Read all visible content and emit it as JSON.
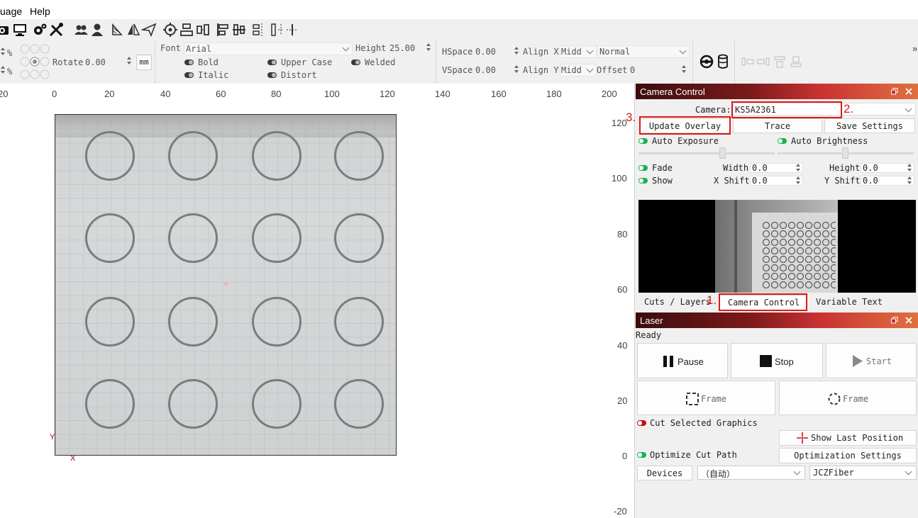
{
  "menu": {
    "language": "uage",
    "help": "Help"
  },
  "toolbar2": {
    "pct1": "%",
    "pct2": "%",
    "rotate_label": "Rotate",
    "rotate_value": "0.00",
    "unit": "mm",
    "font_label": "Font",
    "font_value": "Arial",
    "height_label": "Height",
    "height_value": "25.00",
    "bold": "Bold",
    "italic": "Italic",
    "upper_case": "Upper Case",
    "distort": "Distort",
    "welded": "Welded",
    "hspace_label": "HSpace",
    "hspace_value": "0.00",
    "vspace_label": "VSpace",
    "vspace_value": "0.00",
    "align_x": "Align X",
    "align_x_value": "Midd",
    "align_y": "Align Y",
    "align_y_value": "Midd",
    "normal": "Normal",
    "offset_label": "Offset",
    "offset_value": "0",
    "more": "»"
  },
  "canvas": {
    "x_ruler": [
      "20",
      "0",
      "20",
      "40",
      "60",
      "80",
      "100",
      "120",
      "140",
      "160",
      "180",
      "200"
    ],
    "y_ruler": [
      "120",
      "100",
      "80",
      "60",
      "40",
      "20",
      "0",
      "-20"
    ],
    "y_axis": "Y",
    "x_axis": "X"
  },
  "camera": {
    "title": "Camera Control",
    "camera_label": "Camera:",
    "camera_value": "KS5A2361",
    "update_overlay": "Update Overlay",
    "trace": "Trace",
    "save_settings": "Save Settings",
    "auto_exposure": "Auto Exposure",
    "auto_brightness": "Auto Brightness",
    "fade": "Fade",
    "show": "Show",
    "width_label": "Width",
    "width_value": "0.0",
    "height_label": "Height",
    "height_value": "0.0",
    "xshift_label": "X Shift",
    "xshift_value": "0.0",
    "yshift_label": "Y Shift",
    "yshift_value": "0.0"
  },
  "tabs": {
    "cuts_layers": "Cuts / Layers",
    "camera_control": "Camera Control",
    "variable_text": "Variable Text"
  },
  "annotations": {
    "n1": "1.",
    "n2": "2.",
    "n3": "3."
  },
  "laser": {
    "title": "Laser",
    "status": "Ready",
    "pause": "Pause",
    "stop": "Stop",
    "start": "Start",
    "frame1": "Frame",
    "frame2": "Frame",
    "cut_selected": "Cut Selected Graphics",
    "show_last_position": "Show Last Position",
    "optimize_cut_path": "Optimize Cut Path",
    "optimization_settings": "Optimization Settings",
    "devices": "Devices",
    "mode_value": "（自动）",
    "device_value": "JCZFiber"
  },
  "colors": {
    "accent_red": "#e01818",
    "title_dark": "#3b0d0d",
    "toggle_green": "#19b34c"
  }
}
